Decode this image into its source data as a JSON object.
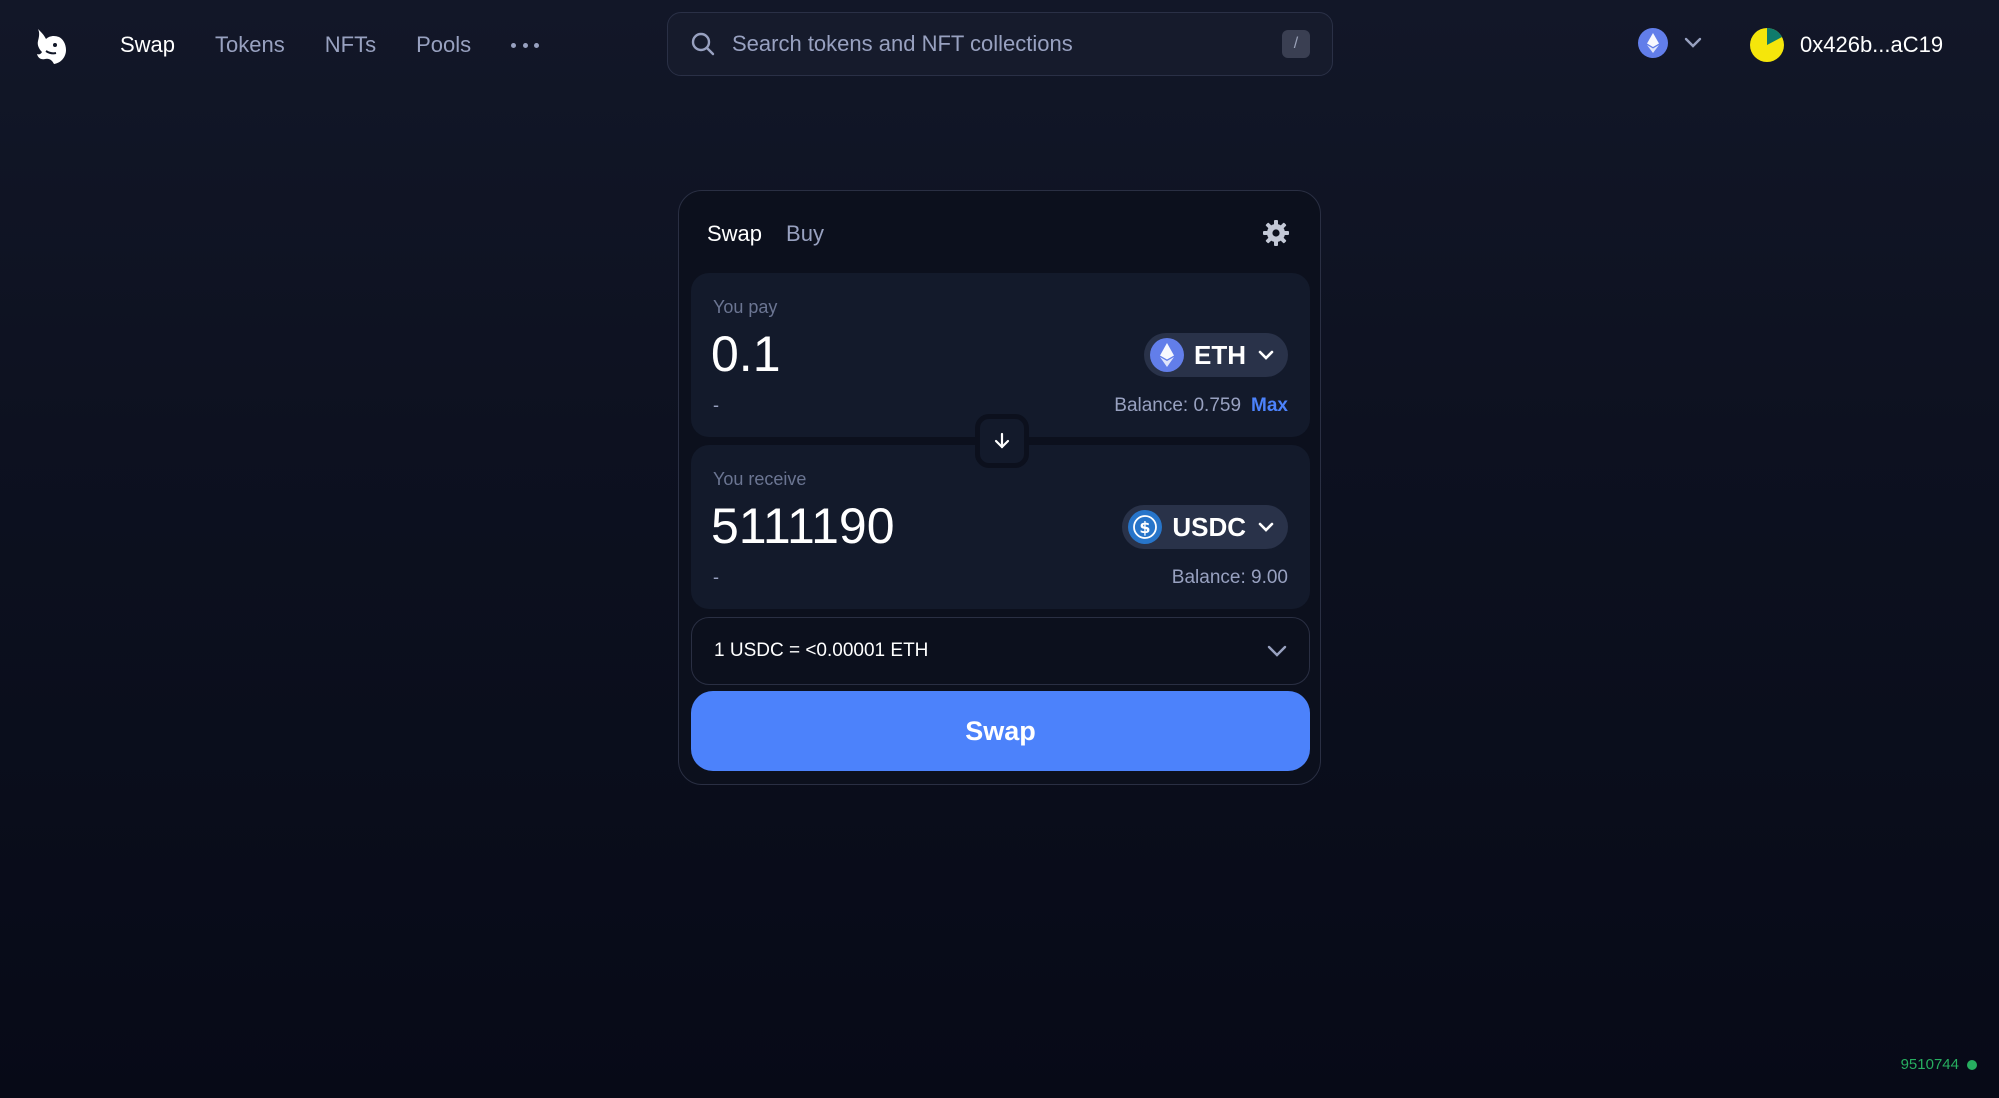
{
  "nav": {
    "items": [
      {
        "label": "Swap",
        "active": true
      },
      {
        "label": "Tokens",
        "active": false
      },
      {
        "label": "NFTs",
        "active": false
      },
      {
        "label": "Pools",
        "active": false
      }
    ],
    "more_icon": "more-dots-icon"
  },
  "search": {
    "placeholder": "Search tokens and NFT collections",
    "shortcut": "/"
  },
  "chain": {
    "icon": "ethereum-icon"
  },
  "wallet": {
    "address": "0x426b...aC19"
  },
  "card": {
    "tabs": [
      {
        "label": "Swap",
        "active": true
      },
      {
        "label": "Buy",
        "active": false
      }
    ],
    "pay": {
      "label": "You pay",
      "amount": "0.1",
      "token": "ETH",
      "usd": "-",
      "balance": "Balance: 0.759",
      "max_label": "Max"
    },
    "receive": {
      "label": "You receive",
      "amount": "5111190",
      "token": "USDC",
      "usd": "-",
      "balance": "Balance: 9.00"
    },
    "rate": "1 USDC = <0.00001 ETH",
    "swap_label": "Swap"
  },
  "footer": {
    "block_number": "9510744"
  },
  "colors": {
    "accent": "#4c82fb",
    "status_ok": "#27ae60",
    "eth": "#627eea",
    "usdc": "#2775ca",
    "avatar_primary": "#f5e60b",
    "avatar_secondary": "#0f7b6c"
  }
}
